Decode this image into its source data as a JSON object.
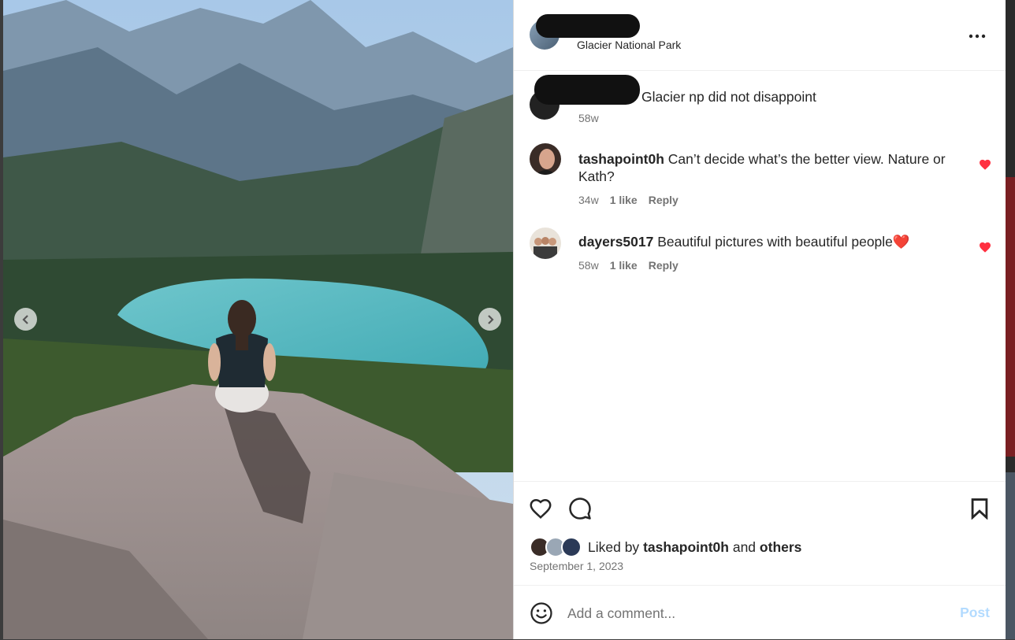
{
  "post": {
    "location": "Glacier National Park",
    "caption": "Glacier np did not disappoint",
    "caption_time": "58w",
    "more_icon": "more-horizontal-icon"
  },
  "comments": [
    {
      "username": "tashapoint0h",
      "text": "Can’t decide what’s the better view. Nature or Kath?",
      "time": "34w",
      "likes": "1 like",
      "reply": "Reply",
      "liked": true
    },
    {
      "username": "dayers5017",
      "text": "Beautiful pictures with beautiful people",
      "emoji": "❤️",
      "time": "58w",
      "likes": "1 like",
      "reply": "Reply",
      "liked": true
    }
  ],
  "actions": {
    "like_icon": "heart-outline-icon",
    "comment_icon": "comment-bubble-icon",
    "save_icon": "bookmark-icon"
  },
  "likes_summary": {
    "prefix": "Liked by",
    "user": "tashapoint0h",
    "middle": "and",
    "others": "others"
  },
  "post_date": "September 1, 2023",
  "comment_box": {
    "placeholder": "Add a comment...",
    "post_label": "Post",
    "emoji_icon": "smiley-icon"
  },
  "colors": {
    "heart_red": "#ff3040",
    "post_disabled": "#b3dbff",
    "text_primary": "#262626",
    "text_secondary": "#737373"
  }
}
